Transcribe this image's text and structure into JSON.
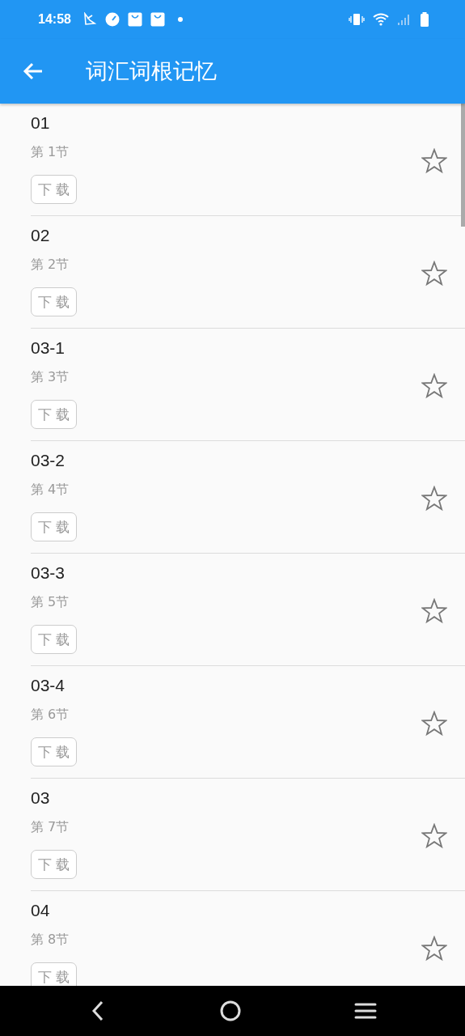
{
  "status_bar": {
    "time": "14:58"
  },
  "app_bar": {
    "title": "词汇词根记忆"
  },
  "lessons": [
    {
      "title": "01",
      "subtitle": "第 1节",
      "button": "下 载",
      "starred": false
    },
    {
      "title": "02",
      "subtitle": "第 2节",
      "button": "下 载",
      "starred": false
    },
    {
      "title": "03-1",
      "subtitle": "第 3节",
      "button": "下 载",
      "starred": false
    },
    {
      "title": "03-2",
      "subtitle": "第 4节",
      "button": "下 载",
      "starred": false
    },
    {
      "title": "03-3",
      "subtitle": "第 5节",
      "button": "下 载",
      "starred": false
    },
    {
      "title": "03-4",
      "subtitle": "第 6节",
      "button": "下 载",
      "starred": false
    },
    {
      "title": "03",
      "subtitle": "第 7节",
      "button": "下 载",
      "starred": false
    },
    {
      "title": "04",
      "subtitle": "第 8节",
      "button": "下 载",
      "starred": false
    }
  ]
}
